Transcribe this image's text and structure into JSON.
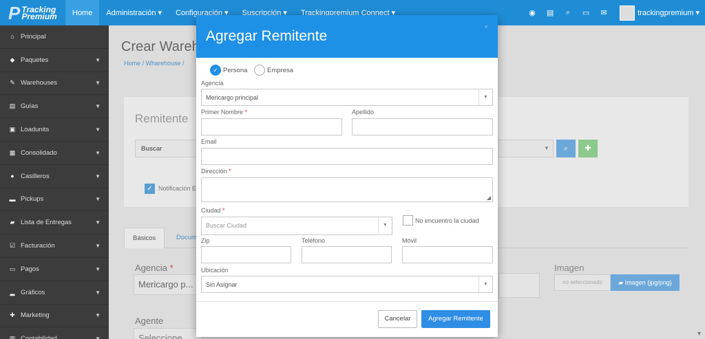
{
  "topbar": {
    "logo_line1": "Tracking",
    "logo_line2": "Premium",
    "nav": [
      "Home",
      "Administración ▾",
      "Configuración ▾",
      "Suscripción ▾",
      "Trackingpremium Connect ▾"
    ],
    "icons": [
      "globe-icon",
      "list-icon",
      "search-icon",
      "money-icon",
      "mail-icon"
    ],
    "user": "trackingpremium ▾"
  },
  "sidebar": {
    "items": [
      {
        "label": "Principal",
        "icon": "home-icon",
        "glyph": "⌂",
        "caret": ""
      },
      {
        "label": "Paquetes",
        "icon": "tag-icon",
        "glyph": "◆",
        "caret": "▼"
      },
      {
        "label": "Warehouses",
        "icon": "edit-icon",
        "glyph": "✎",
        "caret": "▼"
      },
      {
        "label": "Guías",
        "icon": "table-icon",
        "glyph": "▤",
        "caret": "▼"
      },
      {
        "label": "Loadunits",
        "icon": "box-icon",
        "glyph": "▣",
        "caret": "▼"
      },
      {
        "label": "Consolidado",
        "icon": "grid-icon",
        "glyph": "▦",
        "caret": "▼"
      },
      {
        "label": "Casilleros",
        "icon": "pin-icon",
        "glyph": "●",
        "caret": "▼"
      },
      {
        "label": "Pickups",
        "icon": "car-icon",
        "glyph": "▬",
        "caret": "▼"
      },
      {
        "label": "Lista de Entregas",
        "icon": "truck-icon",
        "glyph": "▰",
        "caret": "▼"
      },
      {
        "label": "Facturación",
        "icon": "check-square-icon",
        "glyph": "☑",
        "caret": "▼"
      },
      {
        "label": "Pagos",
        "icon": "money-icon",
        "glyph": "▭",
        "caret": "▼"
      },
      {
        "label": "Gráficos",
        "icon": "chart-icon",
        "glyph": "▂",
        "caret": "▼"
      },
      {
        "label": "Marketing",
        "icon": "user-plus-icon",
        "glyph": "✚",
        "caret": "▼"
      },
      {
        "label": "Contabilidad",
        "icon": "book-icon",
        "glyph": "▥",
        "caret": "▼"
      }
    ]
  },
  "main": {
    "title": "Crear Wareh",
    "breadcrumb": "Home  /  Wharehouse  /",
    "panel_title": "Remitente",
    "search_value": "Buscar",
    "notif_label": "Notificación E",
    "tabs": [
      "Básicos",
      "Docume"
    ],
    "agencia_label": "Agencia",
    "agencia_value": "Mericargo p...",
    "agente_label": "Agente",
    "agente_value": "Seleccione ...",
    "imagen_label": "Imagen",
    "imagen_none": "no seleccionado",
    "imagen_button": "Imagen (jpg/png)"
  },
  "modal": {
    "title": "Agregar Remitente",
    "close": "×",
    "radio_persona": "Persona",
    "radio_empresa": "Empresa",
    "agencia_label": "Agencia",
    "agencia_value": "Mericargo principal",
    "primer_nombre_label": "Primer Nombre",
    "apellido_label": "Apellido",
    "email_label": "Email",
    "direccion_label": "Dirección",
    "ciudad_label": "Ciudad",
    "ciudad_placeholder": "Buscar Ciudad",
    "no_ciudad_label": "No encuentro la ciudad",
    "zip_label": "Zip",
    "telefono_label": "Teléfono",
    "movil_label": "Móvil",
    "ubicacion_label": "Ubicación",
    "ubicacion_value": "Sin Asignar",
    "required_mark": "*",
    "cancel_label": "Cancelar",
    "submit_label": "Agregar Remitente"
  },
  "colors": {
    "primary": "#1e90e6",
    "sidebar": "#3c3c3c",
    "success": "#8cc98c"
  }
}
